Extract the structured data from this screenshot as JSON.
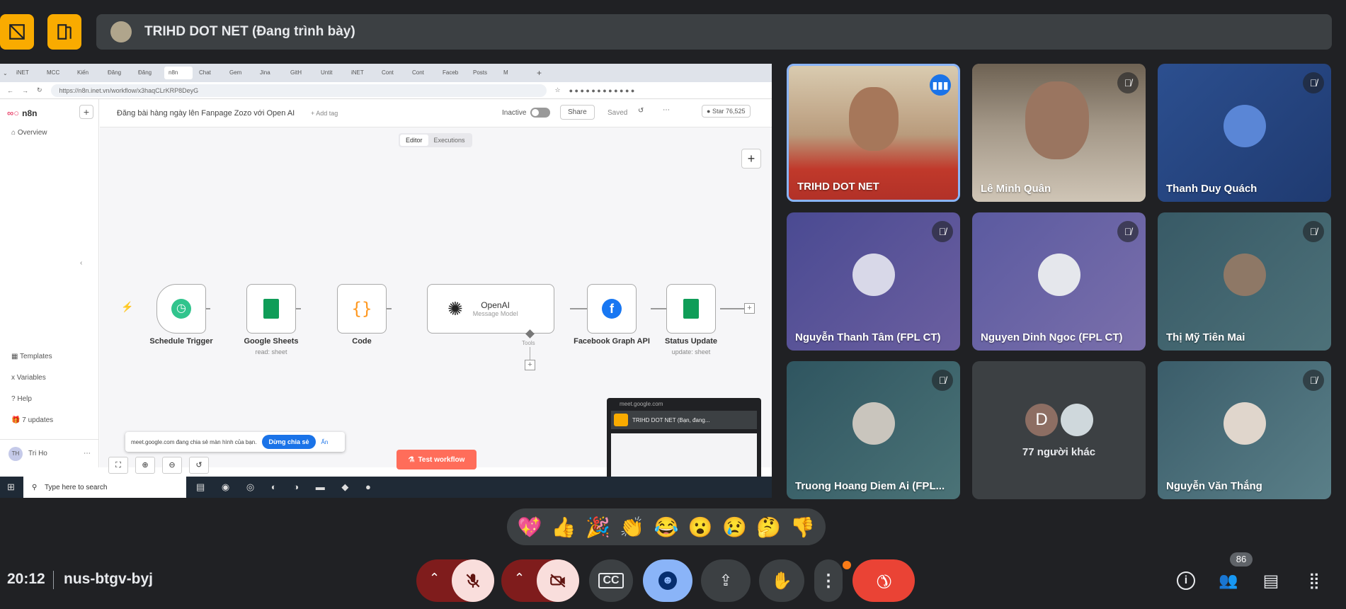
{
  "presenter_bar": {
    "title": "TRIHD DOT NET (Đang trình bày)"
  },
  "browser": {
    "tabs": [
      "iNET",
      "MCC",
      "Kiến",
      "Đăng",
      "Đăng",
      "n8n",
      "Chat",
      "Gem",
      "Jina",
      "GitH",
      "Untit",
      "iNET",
      "Cont",
      "Cont",
      "Faceb",
      "Posts",
      "M"
    ],
    "url": "https://n8n.inet.vn/workflow/x3haqCLrKRP8DeyG"
  },
  "n8n": {
    "logo": "n8n",
    "sidebar_overview": "Overview",
    "sidebar_bottom": [
      "Templates",
      "Variables",
      "Help",
      "7 updates"
    ],
    "user": "Tri Ho",
    "user_initials": "TH",
    "workflow_title": "Đăng bài hàng ngày lên Fanpage Zozo với Open AI",
    "add_tag": "+ Add tag",
    "status": "Inactive",
    "share": "Share",
    "saved": "Saved",
    "star_label": "Star",
    "star_count": "76,525",
    "tab_editor": "Editor",
    "tab_executions": "Executions",
    "nodes": [
      {
        "label": "Schedule Trigger",
        "sub": ""
      },
      {
        "label": "Google Sheets",
        "sub": "read: sheet"
      },
      {
        "label": "Code",
        "sub": ""
      },
      {
        "label": "OpenAI",
        "sub": "Message Model"
      },
      {
        "label": "Facebook Graph API",
        "sub": ""
      },
      {
        "label": "Status Update",
        "sub": "update: sheet"
      }
    ],
    "tools_label": "Tools",
    "test_button": "Test workflow",
    "share_notice": "meet.google.com đang chia sẻ màn hình của bạn.",
    "stop_share": "Dừng chia sẻ",
    "hide": "Ẩn"
  },
  "pip": {
    "url": "meet.google.com",
    "title": "TRIHD DOT NET (Bạn, đang..."
  },
  "taskbar": {
    "search_placeholder": "Type here to search"
  },
  "participants": [
    {
      "name": "TRIHD DOT NET",
      "muted": false,
      "speaking": true
    },
    {
      "name": "Lê Minh Quân",
      "muted": true
    },
    {
      "name": "Thanh Duy Quách",
      "muted": true
    },
    {
      "name": "Nguyễn Thanh Tâm (FPL CT)",
      "muted": true
    },
    {
      "name": "Nguyen Dinh Ngoc (FPL CT)",
      "muted": true
    },
    {
      "name": "Thị Mỹ Tiên Mai",
      "muted": true
    },
    {
      "name": "Truong Hoang Diem Ai (FPL...",
      "muted": true
    },
    {
      "name": "77 người khác",
      "initial": "D"
    },
    {
      "name": "Nguyễn Văn Thắng",
      "muted": true
    }
  ],
  "reactions": [
    "💖",
    "👍",
    "🎉",
    "👏",
    "😂",
    "😮",
    "😢",
    "🤔",
    "👎"
  ],
  "meeting": {
    "time": "20:12",
    "code": "nus-btgv-byj",
    "people_count": "86"
  },
  "colors": {
    "bg": "#202124",
    "accent_yellow": "#f9ab00",
    "end_call": "#ea4335",
    "muted_red": "#f9dedc",
    "active_blue": "#8ab4f8",
    "n8n_orange": "#ff6d5a"
  }
}
